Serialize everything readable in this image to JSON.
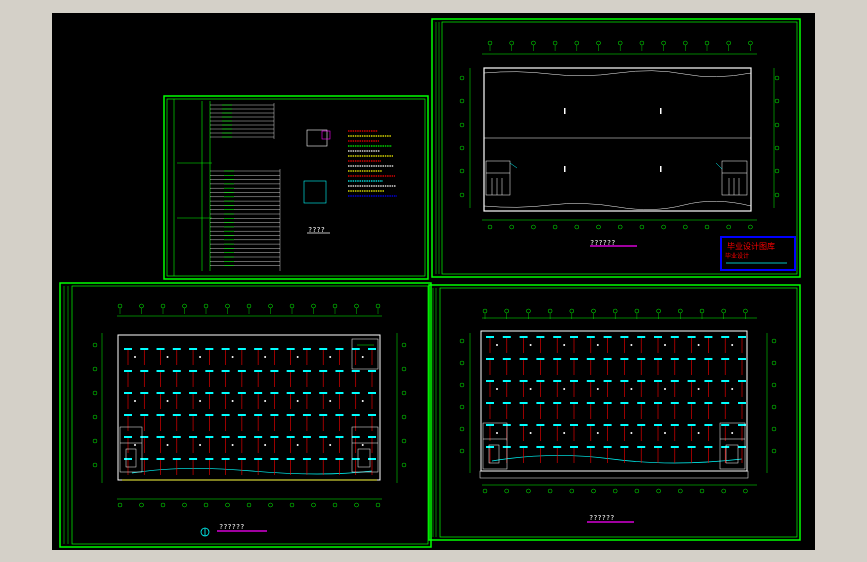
{
  "colors": {
    "background": "#000000",
    "frame": "#00ff00",
    "cyan": "#00ffff",
    "red": "#ff0000",
    "yellow": "#ffff00",
    "white": "#ffffff",
    "magenta": "#ff00ff",
    "blue": "#0000ff"
  },
  "sheets": {
    "system_diagram": {
      "caption": "????"
    },
    "top_roof_plan": {
      "caption": "??????"
    },
    "bottom_left_plan": {
      "caption": "??????"
    },
    "bottom_right_plan": {
      "caption": "??????"
    }
  },
  "title_block": {
    "stamp_line1": "毕业设计图库",
    "stamp_line2": "毕业设计"
  }
}
